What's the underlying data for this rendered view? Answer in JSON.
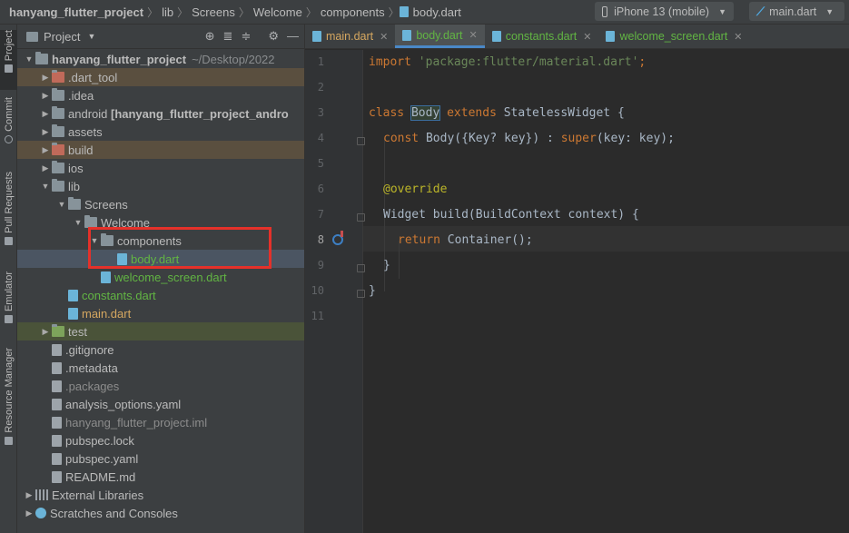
{
  "breadcrumb": [
    "hanyang_flutter_project",
    "lib",
    "Screens",
    "Welcome",
    "components",
    "body.dart"
  ],
  "toolbar": {
    "device": "iPhone 13 (mobile)",
    "run_config": "main.dart"
  },
  "left_stripe": {
    "tabs": [
      "Project",
      "Commit",
      "Pull Requests",
      "Emulator",
      "Resource Manager"
    ]
  },
  "project_panel": {
    "title": "Project",
    "tree": [
      {
        "depth": 0,
        "label": "hanyang_flutter_project",
        "suffix": "~/Desktop/2022",
        "expanded": true,
        "kind": "folder"
      },
      {
        "depth": 1,
        "label": ".dart_tool",
        "kind": "folder",
        "style": "excluded"
      },
      {
        "depth": 1,
        "label": ".idea",
        "kind": "folder"
      },
      {
        "depth": 1,
        "label": "android [hanyang_flutter_project_andro",
        "kind": "folder"
      },
      {
        "depth": 1,
        "label": "assets",
        "kind": "folder"
      },
      {
        "depth": 1,
        "label": "build",
        "kind": "folder",
        "style": "excluded"
      },
      {
        "depth": 1,
        "label": "ios",
        "kind": "folder"
      },
      {
        "depth": 1,
        "label": "lib",
        "kind": "folder",
        "expanded": true
      },
      {
        "depth": 2,
        "label": "Screens",
        "kind": "folder",
        "expanded": true
      },
      {
        "depth": 3,
        "label": "Welcome",
        "kind": "folder",
        "expanded": true
      },
      {
        "depth": 4,
        "label": "components",
        "kind": "folder",
        "expanded": true
      },
      {
        "depth": 5,
        "label": "body.dart",
        "kind": "dart",
        "selected": true
      },
      {
        "depth": 4,
        "label": "welcome_screen.dart",
        "kind": "dart"
      },
      {
        "depth": 2,
        "label": "constants.dart",
        "kind": "dart"
      },
      {
        "depth": 2,
        "label": "main.dart",
        "kind": "dart"
      },
      {
        "depth": 1,
        "label": "test",
        "kind": "folder",
        "style": "test"
      },
      {
        "depth": 1,
        "label": ".gitignore",
        "kind": "file"
      },
      {
        "depth": 1,
        "label": ".metadata",
        "kind": "file"
      },
      {
        "depth": 1,
        "label": ".packages",
        "kind": "file",
        "style": "dim"
      },
      {
        "depth": 1,
        "label": "analysis_options.yaml",
        "kind": "file"
      },
      {
        "depth": 1,
        "label": "hanyang_flutter_project.iml",
        "kind": "file",
        "style": "dim"
      },
      {
        "depth": 1,
        "label": "pubspec.lock",
        "kind": "file"
      },
      {
        "depth": 1,
        "label": "pubspec.yaml",
        "kind": "file"
      },
      {
        "depth": 1,
        "label": "README.md",
        "kind": "file"
      },
      {
        "depth": 0,
        "label": "External Libraries",
        "kind": "lib"
      },
      {
        "depth": 0,
        "label": "Scratches and Consoles",
        "kind": "scratch"
      }
    ]
  },
  "editor": {
    "tabs": [
      {
        "label": "main.dart",
        "color": "orange"
      },
      {
        "label": "body.dart",
        "color": "green",
        "active": true
      },
      {
        "label": "constants.dart",
        "color": "green"
      },
      {
        "label": "welcome_screen.dart",
        "color": "green"
      }
    ],
    "line_numbers": [
      "1",
      "2",
      "3",
      "4",
      "5",
      "6",
      "7",
      "8",
      "9",
      "10",
      "11"
    ],
    "current_line": "8",
    "code": {
      "l1_kw": "import",
      "l1_str": " 'package:flutter/material.dart'",
      "l1_end": ";",
      "l3_class": "class",
      "l3_name": "Body",
      "l3_extends": " extends ",
      "l3_super": "StatelessWidget",
      "l3_brace": " {",
      "l4_const": "const",
      "l4_rest1": " Body({",
      "l4_key": "Key",
      "l4_rest2": "? key}) : ",
      "l4_super": "super",
      "l4_rest3": "(key: key);",
      "l6_ann": "@override",
      "l7_type": "Widget",
      "l7_rest": " build(",
      "l7_ctx": "BuildContext",
      "l7_end": " context) {",
      "l8_ret": "return",
      "l8_rest": " Container();",
      "l9": "}",
      "l10": "}"
    }
  },
  "colors": {
    "highlight_box": "#e5312a",
    "keyword": "#cc7832",
    "string": "#6a8759",
    "annotation": "#bbb529"
  }
}
